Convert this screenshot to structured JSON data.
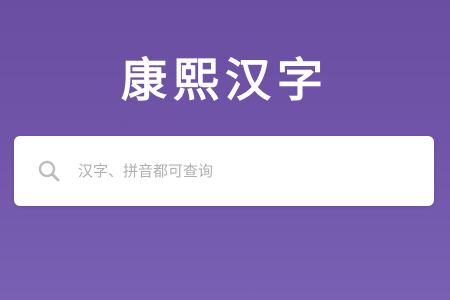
{
  "app": {
    "title": "康熙汉字"
  },
  "search": {
    "value": "",
    "placeholder": "汉字、拼音都可查询",
    "icon": "search-icon"
  },
  "colors": {
    "background_top": "#6a4ea2",
    "background_bottom": "#7a60b3",
    "title_text": "#ffffff",
    "search_box": "#ffffff",
    "placeholder_text": "#b0b0b0",
    "icon": "#bdbdbd"
  }
}
